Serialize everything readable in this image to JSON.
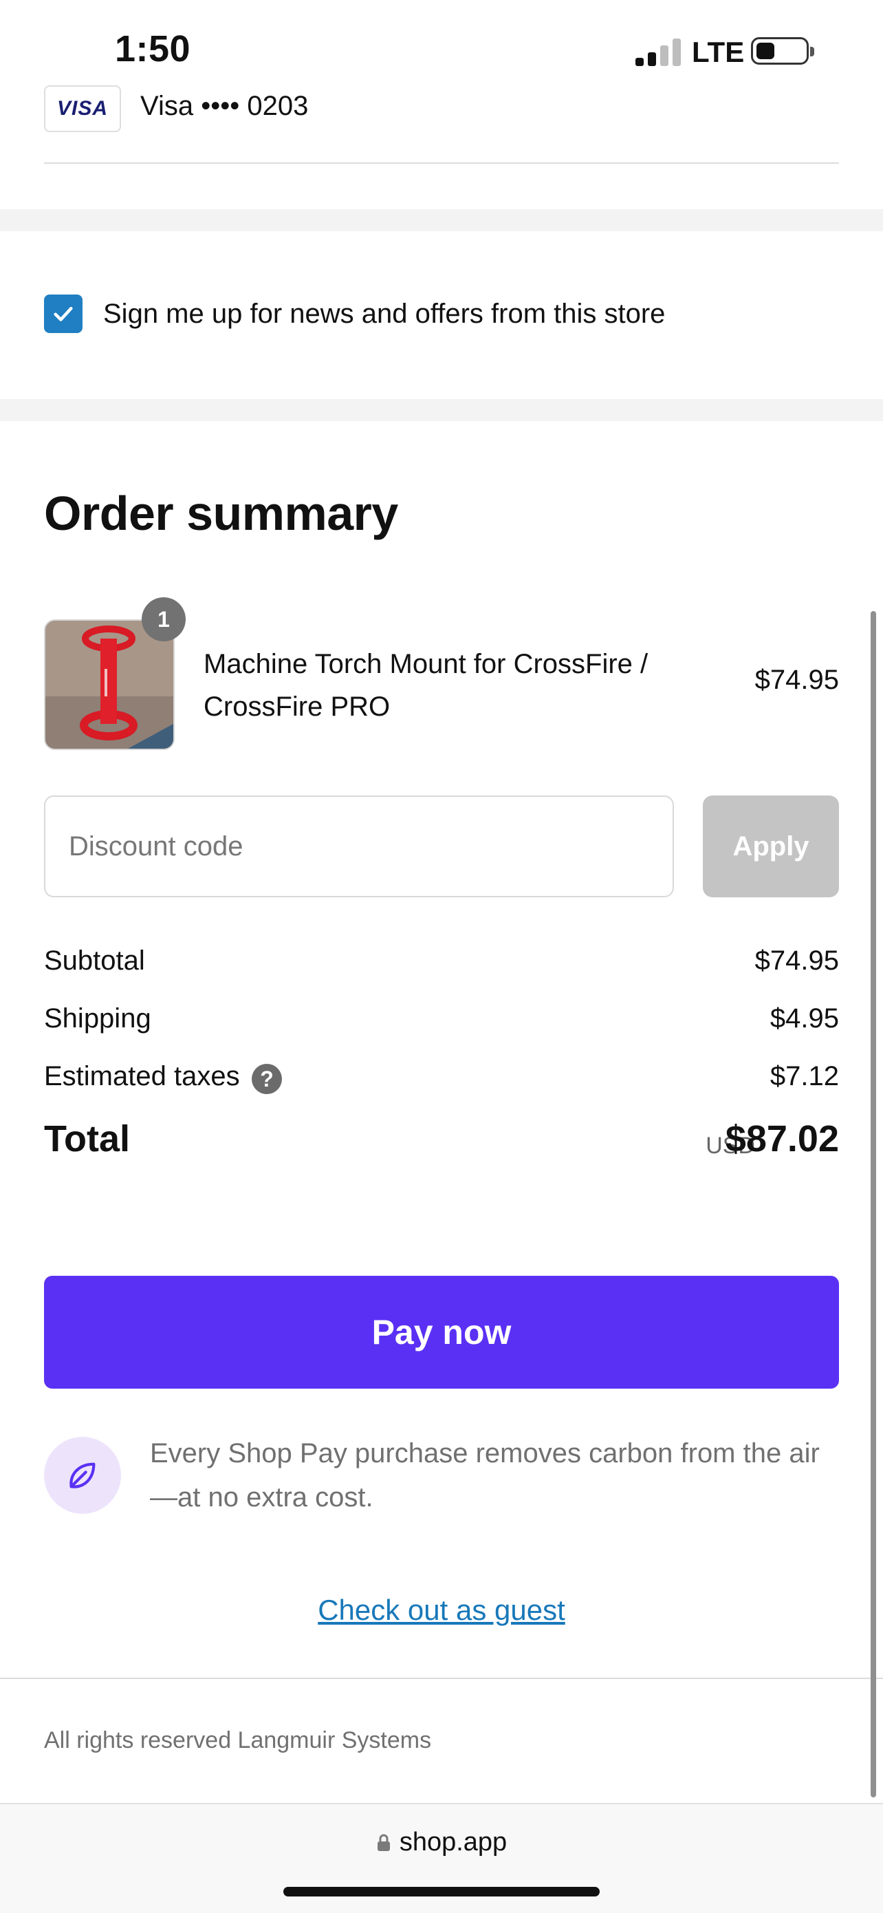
{
  "status_bar": {
    "time": "1:50",
    "network": "LTE",
    "battery_level": 0.35
  },
  "payment": {
    "card_brand": "VISA",
    "card_label": "Visa •••• 0203"
  },
  "newsletter": {
    "checked": true,
    "label": "Sign me up for news and offers from this store"
  },
  "order_summary": {
    "title": "Order summary",
    "item": {
      "quantity": "1",
      "name": "Machine Torch Mount for CrossFire / CrossFire PRO",
      "price": "$74.95"
    },
    "discount": {
      "placeholder": "Discount code",
      "apply_label": "Apply"
    },
    "subtotal": {
      "label": "Subtotal",
      "value": "$74.95"
    },
    "shipping": {
      "label": "Shipping",
      "value": "$4.95"
    },
    "taxes": {
      "label": "Estimated taxes",
      "value": "$7.12",
      "help_icon": "?"
    },
    "total": {
      "label": "Total",
      "currency": "USD",
      "value": "$87.02"
    }
  },
  "pay_button": {
    "label": "Pay now",
    "color": "#5a31f4"
  },
  "carbon_note": {
    "text": "Every Shop Pay purchase removes carbon from the air —at no extra cost.",
    "icon": "leaf-icon"
  },
  "guest_link": {
    "label": "Check out as guest"
  },
  "footer": {
    "text": "All rights reserved Langmuir Systems"
  },
  "browser": {
    "url": "shop.app",
    "icon": "lock-icon"
  },
  "colors": {
    "accent": "#5a31f4",
    "checkbox": "#1f7fc2",
    "link": "#1878b9"
  }
}
